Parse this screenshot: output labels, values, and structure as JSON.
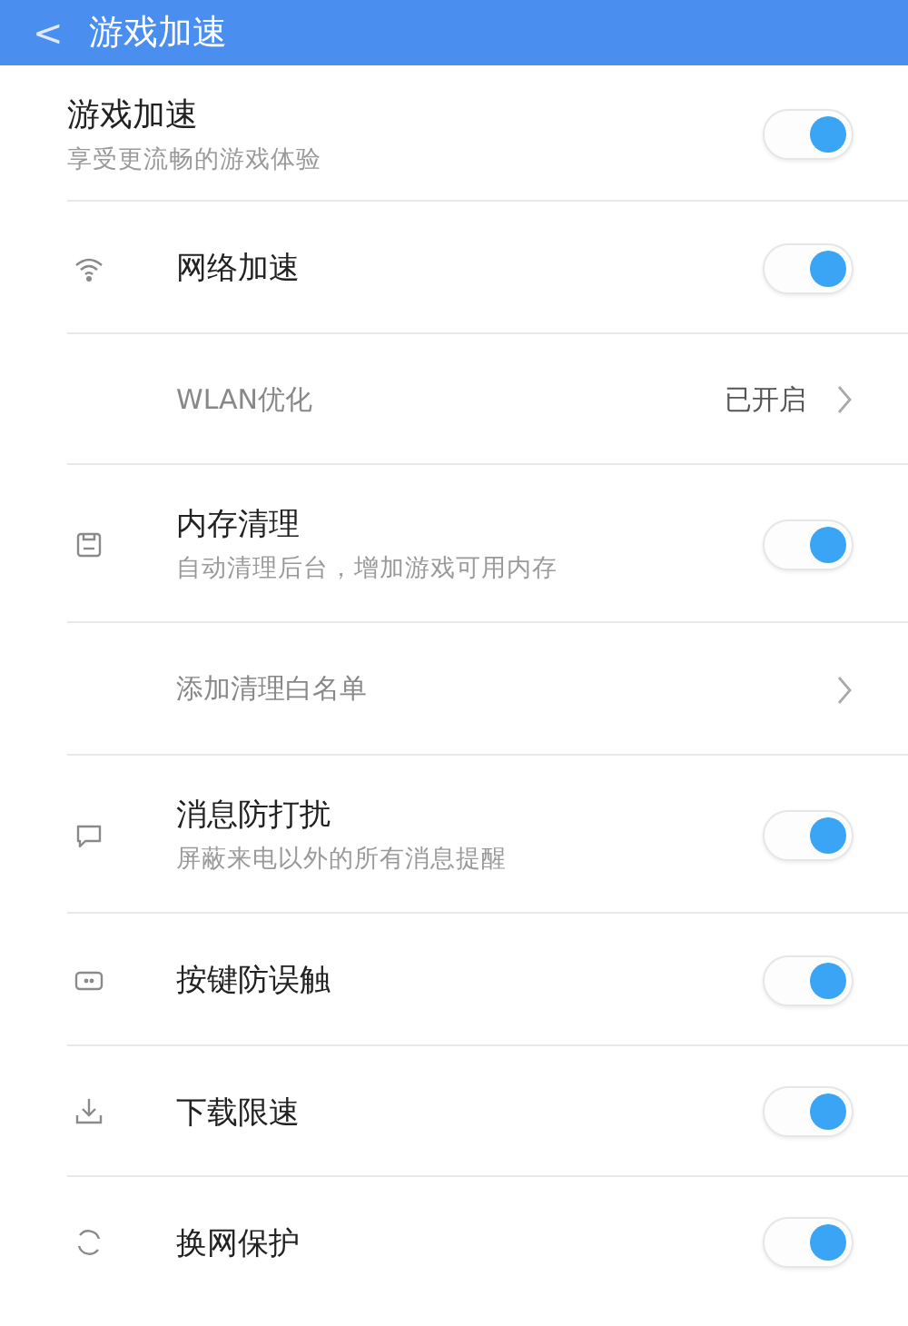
{
  "header": {
    "back": "<",
    "title": "游戏加速"
  },
  "items": [
    {
      "kind": "toggle",
      "title": "游戏加速",
      "subtitle": "享受更流畅的游戏体验",
      "on": true
    },
    {
      "kind": "toggle",
      "title": "网络加速",
      "on": true
    },
    {
      "kind": "link",
      "title": "WLAN优化",
      "value": "已开启"
    },
    {
      "kind": "toggle",
      "title": "内存清理",
      "subtitle": "自动清理后台，增加游戏可用内存",
      "on": true
    },
    {
      "kind": "link",
      "title": "添加清理白名单"
    },
    {
      "kind": "toggle",
      "title": "消息防打扰",
      "subtitle": "屏蔽来电以外的所有消息提醒",
      "on": true
    },
    {
      "kind": "toggle",
      "title": "按键防误触",
      "on": true
    },
    {
      "kind": "toggle",
      "title": "下载限速",
      "on": true
    },
    {
      "kind": "toggle",
      "title": "换网保护",
      "on": true
    }
  ]
}
